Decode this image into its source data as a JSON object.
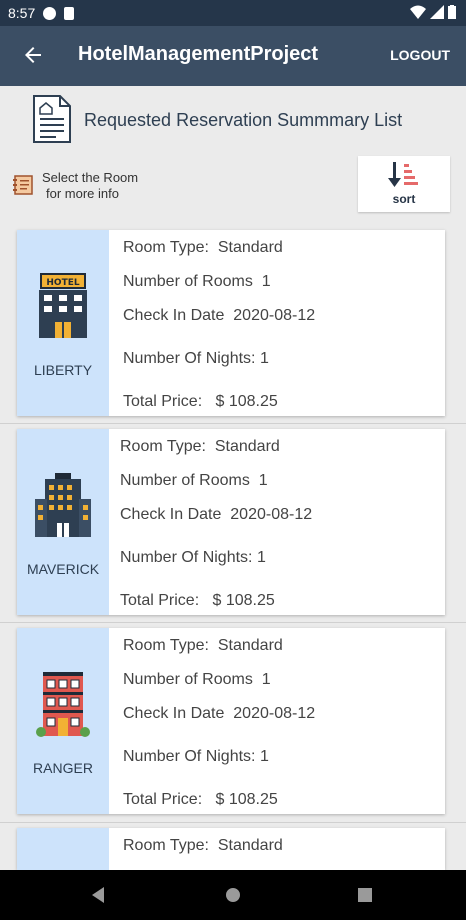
{
  "status_bar": {
    "time": "8:57"
  },
  "app_bar": {
    "title": "HotelManagementProject",
    "logout_label": "LOGOUT"
  },
  "header": {
    "title": "Requested Reservation Summmary List"
  },
  "hint": {
    "line1": "Select the Room",
    "line2": "for more info"
  },
  "sort": {
    "label": "sort"
  },
  "labels": {
    "room_type": "Room Type:",
    "rooms": "Number of Rooms",
    "check_in": "Check In Date",
    "nights": "Number Of Nights:",
    "total": "Total Price:"
  },
  "reservations": [
    {
      "hotel": "LIBERTY",
      "room_type": "Standard",
      "rooms": "1",
      "check_in": "2020-08-12",
      "nights": "1",
      "total": "$ 108.25"
    },
    {
      "hotel": "MAVERICK",
      "room_type": "Standard",
      "rooms": "1",
      "check_in": "2020-08-12",
      "nights": "1",
      "total": "$ 108.25"
    },
    {
      "hotel": "RANGER",
      "room_type": "Standard",
      "rooms": "1",
      "check_in": "2020-08-12",
      "nights": "1",
      "total": "$ 108.25"
    },
    {
      "hotel": "",
      "room_type": "Standard",
      "rooms": "",
      "check_in": "",
      "nights": "",
      "total": ""
    }
  ],
  "colors": {
    "status_bar": "#25364a",
    "app_bar": "#3b4e64",
    "card_left": "#cde3fb"
  }
}
